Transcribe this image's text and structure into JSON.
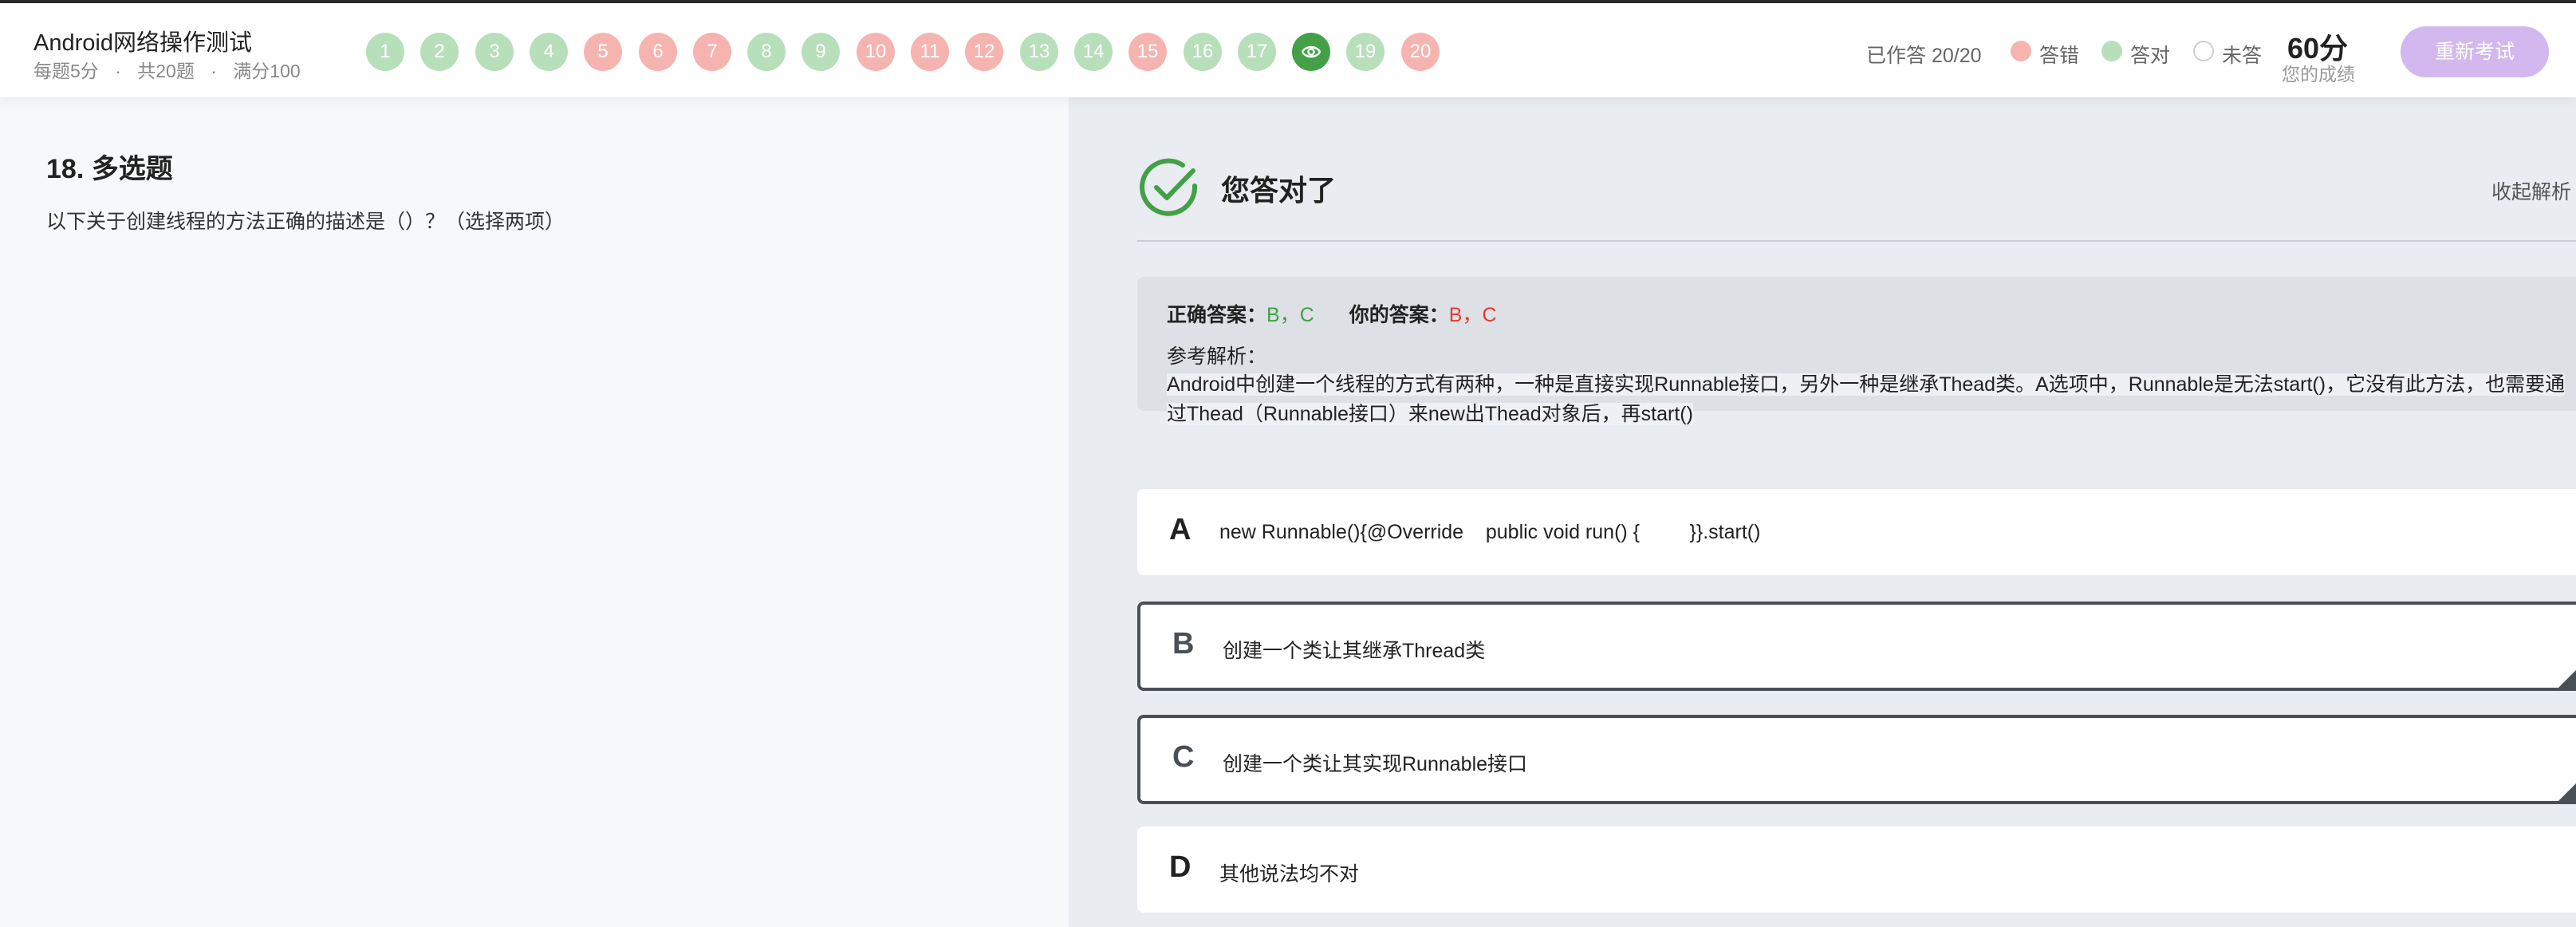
{
  "header": {
    "title": "Android网络操作测试",
    "meta": [
      "每题5分",
      "共20题",
      "满分100"
    ],
    "meta_sep": "·",
    "questions": [
      {
        "label": "1",
        "status": "correct"
      },
      {
        "label": "2",
        "status": "correct"
      },
      {
        "label": "3",
        "status": "correct"
      },
      {
        "label": "4",
        "status": "correct"
      },
      {
        "label": "5",
        "status": "wrong"
      },
      {
        "label": "6",
        "status": "wrong"
      },
      {
        "label": "7",
        "status": "wrong"
      },
      {
        "label": "8",
        "status": "correct"
      },
      {
        "label": "9",
        "status": "correct"
      },
      {
        "label": "10",
        "status": "wrong"
      },
      {
        "label": "11",
        "status": "wrong"
      },
      {
        "label": "12",
        "status": "wrong"
      },
      {
        "label": "13",
        "status": "correct"
      },
      {
        "label": "14",
        "status": "correct"
      },
      {
        "label": "15",
        "status": "wrong"
      },
      {
        "label": "16",
        "status": "correct"
      },
      {
        "label": "17",
        "status": "correct"
      },
      {
        "label": "18",
        "status": "current",
        "icon": "eye-icon"
      },
      {
        "label": "19",
        "status": "correct"
      },
      {
        "label": "20",
        "status": "wrong"
      }
    ],
    "answered": "已作答 20/20",
    "legend": [
      {
        "label": "答错",
        "color": "#f5b4b0"
      },
      {
        "label": "答对",
        "color": "#b7dfba"
      },
      {
        "label": "未答",
        "color": "#ffffff"
      }
    ],
    "score": "60分",
    "score_label": "您的成绩",
    "retake_label": "重新考试"
  },
  "question": {
    "title": "18. 多选题",
    "text": "以下关于创建线程的方法正确的描述是（）？（选择两项）"
  },
  "result": {
    "title": "您答对了",
    "collapse_label": "收起解析",
    "correct_label": "正确答案：",
    "correct_value": "B，C",
    "yours_label": "你的答案：",
    "yours_value": "B，C",
    "analysis_label": "参考解析：",
    "analysis_text": "Android中创建一个线程的方式有两种，一种是直接实现Runnable接口，另外一种是继承Thead类。A选项中，Runnable是无法start()，它没有此方法，也需要通过Thead（Runnable接口）来new出Thead对象后，再start()"
  },
  "options": [
    {
      "letter": "A",
      "text": "new Runnable(){@Override    public void run() {         }}.start()",
      "selected": false
    },
    {
      "letter": "B",
      "text": "创建一个类让其继承Thread类",
      "selected": true
    },
    {
      "letter": "C",
      "text": "创建一个类让其实现Runnable接口",
      "selected": true
    },
    {
      "letter": "D",
      "text": "其他说法均不对",
      "selected": false
    }
  ],
  "colors": {
    "correct": "#43a047",
    "wrong": "#e53935",
    "accent": "#d3b8ef"
  }
}
